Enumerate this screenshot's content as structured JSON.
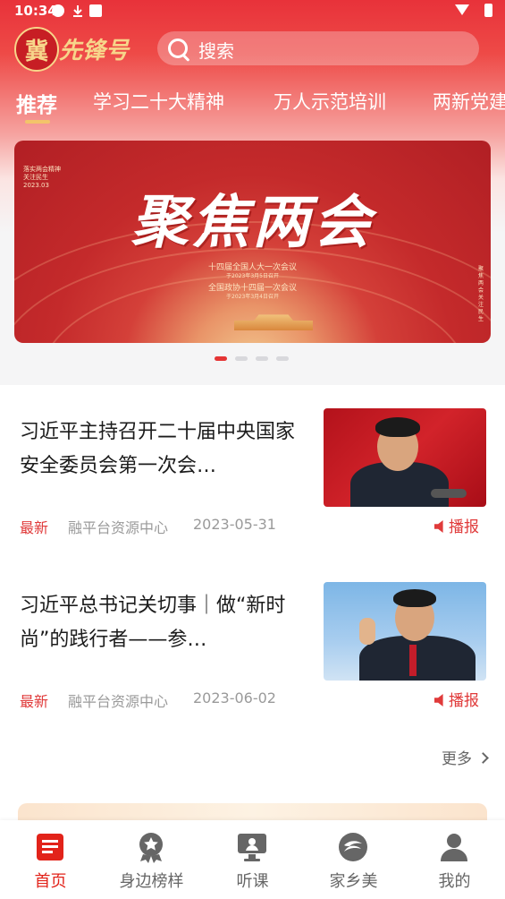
{
  "status_bar": {
    "time": "10:34"
  },
  "header": {
    "logo_char": "冀",
    "logo_text": "先锋号",
    "search_placeholder": "搜索"
  },
  "tabs": [
    {
      "label": "推荐",
      "active": true
    },
    {
      "label": "学习二十大精神"
    },
    {
      "label": "万人示范培训"
    },
    {
      "label": "两新党建"
    }
  ],
  "banner": {
    "title": "聚焦两会",
    "line1": "十四届全国人大一次会议",
    "line2": "于2023年3月5日召开",
    "line3": "全国政协十四届一次会议",
    "line4": "于2023年3月4日召开",
    "corner_text": "落实两会精神\n关注民生\n2023.03",
    "side_text": "聚焦两会关注民生",
    "slide_count": 4,
    "active_slide": 1
  },
  "news": [
    {
      "title": "习近平主持召开二十届中央国家安全委员会第一次会…",
      "tag": "最新",
      "source": "融平台资源中心",
      "date": "2023-05-31",
      "broadcast": "播报"
    },
    {
      "title": "习近平总书记关切事｜做“新时尚”的践行者——参…",
      "tag": "最新",
      "source": "融平台资源中心",
      "date": "2023-06-02",
      "broadcast": "播报"
    }
  ],
  "more_label": "更多",
  "bottom_nav": [
    {
      "label": "首页",
      "icon": "home-news-icon",
      "active": true
    },
    {
      "label": "身边榜样",
      "icon": "star-badge-icon"
    },
    {
      "label": "听课",
      "icon": "lecture-icon"
    },
    {
      "label": "家乡美",
      "icon": "hometown-icon"
    },
    {
      "label": "我的",
      "icon": "user-icon"
    }
  ],
  "colors": {
    "primary_red": "#e2231a",
    "gold": "#f7d58a"
  }
}
